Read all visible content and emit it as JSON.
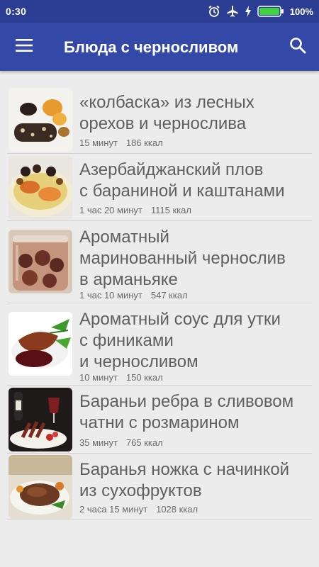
{
  "status_bar": {
    "time": "0:30",
    "battery_percent": "100%",
    "icons": [
      "alarm-icon",
      "airplane-mode-icon",
      "charging-icon",
      "battery-icon"
    ]
  },
  "app_bar": {
    "title": "Блюда с черносливом",
    "menu_icon": "hamburger-menu-icon",
    "search_icon": "search-icon"
  },
  "colors": {
    "status_bar": "#2c3e94",
    "app_bar": "#3448a8",
    "background": "#ececec",
    "title_text": "#5f5f5f",
    "meta_text": "#6a6a6a",
    "battery": "#3fd13f"
  },
  "recipes": [
    {
      "title_lines": [
        "«колбаска» из лесных",
        "орехов и чернослива"
      ],
      "time": "15 минут",
      "calories": "186 ккал"
    },
    {
      "title_lines": [
        "Азербайджанский плов",
        "с бараниной и каштанами"
      ],
      "time": "1 час 20 минут",
      "calories": "1115 ккал"
    },
    {
      "title_lines": [
        "Ароматный",
        "маринованный чернослив",
        "в арманьяке"
      ],
      "time": "1 час 10 минут",
      "calories": "547 ккал"
    },
    {
      "title_lines": [
        "Ароматный соус для утки",
        "с финиками",
        "и черносливом"
      ],
      "time": "10 минут",
      "calories": "150 ккал"
    },
    {
      "title_lines": [
        "Бараньи ребра в сливовом",
        "чатни с розмарином"
      ],
      "time": "35 минут",
      "calories": "765 ккал"
    },
    {
      "title_lines": [
        "Баранья ножка с начинкой",
        "из сухофруктов"
      ],
      "time": "2 часа 15 минут",
      "calories": "1028 ккал"
    }
  ]
}
